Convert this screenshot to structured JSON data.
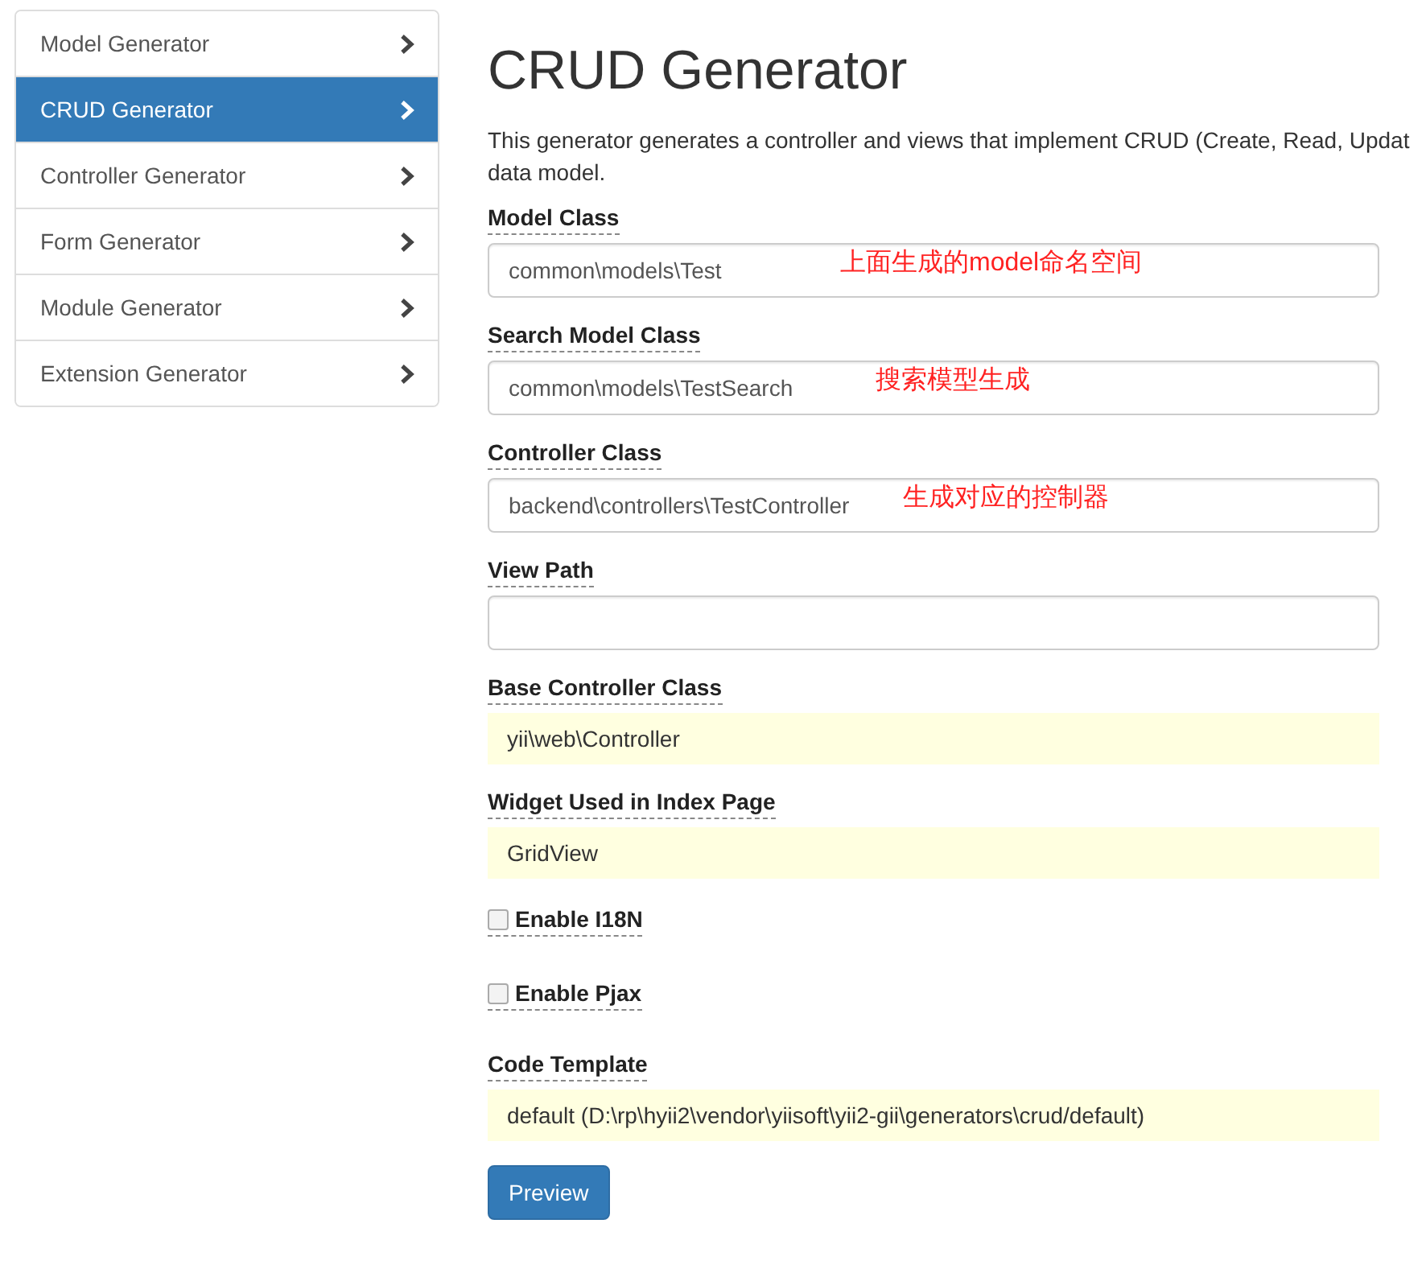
{
  "sidebar": {
    "items": [
      {
        "label": "Model Generator",
        "selected": false
      },
      {
        "label": "CRUD Generator",
        "selected": true
      },
      {
        "label": "Controller Generator",
        "selected": false
      },
      {
        "label": "Form Generator",
        "selected": false
      },
      {
        "label": "Module Generator",
        "selected": false
      },
      {
        "label": "Extension Generator",
        "selected": false
      }
    ]
  },
  "title": "CRUD Generator",
  "description_lines": [
    "This generator generates a controller and views that implement CRUD (Create, Read, Updat",
    "data model."
  ],
  "fields": [
    {
      "kind": "text",
      "label": "Model Class",
      "value": "common\\models\\Test",
      "note": "上面生成的model命名空间"
    },
    {
      "kind": "text",
      "label": "Search Model Class",
      "value": "common\\models\\TestSearch",
      "note": "搜索模型生成"
    },
    {
      "kind": "text",
      "label": "Controller Class",
      "value": "backend\\controllers\\TestController",
      "note": "生成对应的控制器"
    },
    {
      "kind": "text",
      "label": "View Path"
    },
    {
      "kind": "sticky",
      "label": "Base Controller Class",
      "value": "yii\\web\\Controller"
    },
    {
      "kind": "sticky",
      "label": "Widget Used in Index Page",
      "value": "GridView"
    },
    {
      "kind": "checkbox",
      "label": "Enable I18N",
      "checked": false
    },
    {
      "kind": "checkbox",
      "label": "Enable Pjax",
      "checked": false
    },
    {
      "kind": "sticky",
      "label": "Code Template",
      "value": "default (D:\\rp\\hyii2\\vendor\\yiisoft\\yii2-gii\\generators\\crud/default)"
    }
  ],
  "preview_button": "Preview"
}
